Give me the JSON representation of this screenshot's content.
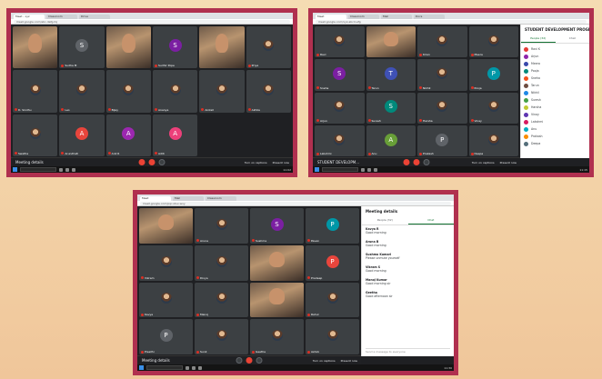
{
  "colors": {
    "frame": "#b0304f",
    "meet_bg": "#1f2023",
    "accent_green": "#137333",
    "hangup_red": "#ea4335"
  },
  "screen1": {
    "tabs": [
      "Meet - xyz",
      "Classroom",
      "Drive"
    ],
    "url": "meet.google.com/abc-defg-hij",
    "tiles": [
      {
        "type": "video",
        "name": ""
      },
      {
        "type": "avatar",
        "letter": "S",
        "color": "#5f6368",
        "name": "Sudha M"
      },
      {
        "type": "video",
        "name": ""
      },
      {
        "type": "avatar",
        "letter": "S",
        "color": "#7b1fa2",
        "name": "Sudhir Pope"
      },
      {
        "type": "video",
        "name": ""
      },
      {
        "type": "photo",
        "name": "Priya"
      },
      {
        "type": "photo",
        "name": "D. Sindhu"
      },
      {
        "type": "photo",
        "name": "Leo"
      },
      {
        "type": "photo",
        "name": "Bijay"
      },
      {
        "type": "photo",
        "name": "Ananya"
      },
      {
        "type": "photo",
        "name": "Aniket"
      },
      {
        "type": "photo",
        "name": "Akhila"
      },
      {
        "type": "photo",
        "name": "Swetha"
      },
      {
        "type": "avatar",
        "letter": "A",
        "color": "#e8453c",
        "name": "Arundhati"
      },
      {
        "type": "avatar",
        "letter": "A",
        "color": "#9c27b0",
        "name": "Anil R"
      },
      {
        "type": "avatar",
        "letter": "A",
        "color": "#ec407a",
        "name": "Aditi"
      }
    ],
    "meeting_details": "Meeting details",
    "tools": [
      "Turn on captions",
      "Present now"
    ],
    "time": "11:02"
  },
  "screen2": {
    "tabs": [
      "Meet",
      "Classroom",
      "Mail",
      "Docs"
    ],
    "url": "meet.google.com/xyz-abcd-efg",
    "tiles": [
      {
        "type": "photo",
        "name": "Ravi"
      },
      {
        "type": "video",
        "name": ""
      },
      {
        "type": "photo",
        "name": "Kiran"
      },
      {
        "type": "photo",
        "name": "Meera"
      },
      {
        "type": "avatar",
        "letter": "S",
        "color": "#7b1fa2",
        "name": "Sneha"
      },
      {
        "type": "avatar",
        "letter": "T",
        "color": "#3f51b5",
        "name": "Tarun"
      },
      {
        "type": "photo",
        "name": "Nikhil"
      },
      {
        "type": "avatar",
        "letter": "P",
        "color": "#0097a7",
        "name": "Pooja"
      },
      {
        "type": "photo",
        "name": "Arjun"
      },
      {
        "type": "avatar",
        "letter": "S",
        "color": "#00897b",
        "name": "Suresh"
      },
      {
        "type": "photo",
        "name": "Harsha"
      },
      {
        "type": "photo",
        "name": "Vinay"
      },
      {
        "type": "photo",
        "name": "Lakshmi"
      },
      {
        "type": "avatar",
        "letter": "A",
        "color": "#689f38",
        "name": "Anu"
      },
      {
        "type": "avatar",
        "letter": "P",
        "color": "#5f6368",
        "name": "Prakash"
      },
      {
        "type": "photo",
        "name": "Deepa"
      }
    ],
    "meeting_details": "STUDENT DEVELOPM...",
    "side_title": "STUDENT DEVELOPMENT PROGRA...",
    "side_tabs": [
      "People (32)",
      "Chat"
    ],
    "people": [
      "Ravi K",
      "Arjun",
      "Meera",
      "Pooja",
      "Sneha",
      "Tarun",
      "Nikhil",
      "Suresh",
      "Harsha",
      "Vinay",
      "Lakshmi",
      "Anu",
      "Prakash",
      "Deepa"
    ],
    "person_colors": [
      "#e53935",
      "#8e24aa",
      "#3949ab",
      "#00897b",
      "#f4511e",
      "#6d4c41",
      "#1e88e5",
      "#43a047",
      "#c0ca33",
      "#5e35b1",
      "#d81b60",
      "#00acc1",
      "#fb8c00",
      "#546e7a"
    ],
    "tools": [
      "Turn on captions",
      "Present now"
    ],
    "time": "11:15"
  },
  "screen3": {
    "tabs": [
      "Meet",
      "Mail",
      "Classroom"
    ],
    "url": "meet.google.com/pqr-stuv-wxy",
    "tiles": [
      {
        "type": "video",
        "name": ""
      },
      {
        "type": "photo",
        "name": "Aruna"
      },
      {
        "type": "avatar",
        "letter": "S",
        "color": "#7b1fa2",
        "name": "Sushma"
      },
      {
        "type": "avatar",
        "letter": "P",
        "color": "#0097a7",
        "name": "Pavan"
      },
      {
        "type": "photo",
        "name": "Vikram"
      },
      {
        "type": "photo",
        "name": "Divya"
      },
      {
        "type": "video",
        "name": ""
      },
      {
        "type": "avatar",
        "letter": "P",
        "color": "#e8453c",
        "name": "Pradeep"
      },
      {
        "type": "photo",
        "name": "Kavya"
      },
      {
        "type": "photo",
        "name": "Manoj"
      },
      {
        "type": "video",
        "name": ""
      },
      {
        "type": "photo",
        "name": "Rahul"
      },
      {
        "type": "avatar",
        "letter": "P",
        "color": "#5f6368",
        "name": "Preethi"
      },
      {
        "type": "photo",
        "name": "Sunil"
      },
      {
        "type": "photo",
        "name": "Geetha"
      },
      {
        "type": "photo",
        "name": "Ashok"
      }
    ],
    "meeting_details": "Meeting details",
    "side_title": "Meeting details",
    "side_tabs": [
      "People (32)",
      "Chat"
    ],
    "chat": [
      {
        "who": "Kavya R",
        "txt": "Good morning"
      },
      {
        "who": "Aruna B",
        "txt": "Good morning"
      },
      {
        "who": "Sushma Kumari",
        "txt": "Please unmute yourself"
      },
      {
        "who": "Vikram S",
        "txt": "Good morning"
      },
      {
        "who": "Manoj Kumar",
        "txt": "Good morning sir"
      },
      {
        "who": "Geetha",
        "txt": "Good afternoon sir"
      }
    ],
    "chat_placeholder": "Send a message to everyone",
    "tools": [
      "Turn on captions",
      "Present now"
    ],
    "time": "11:30"
  }
}
